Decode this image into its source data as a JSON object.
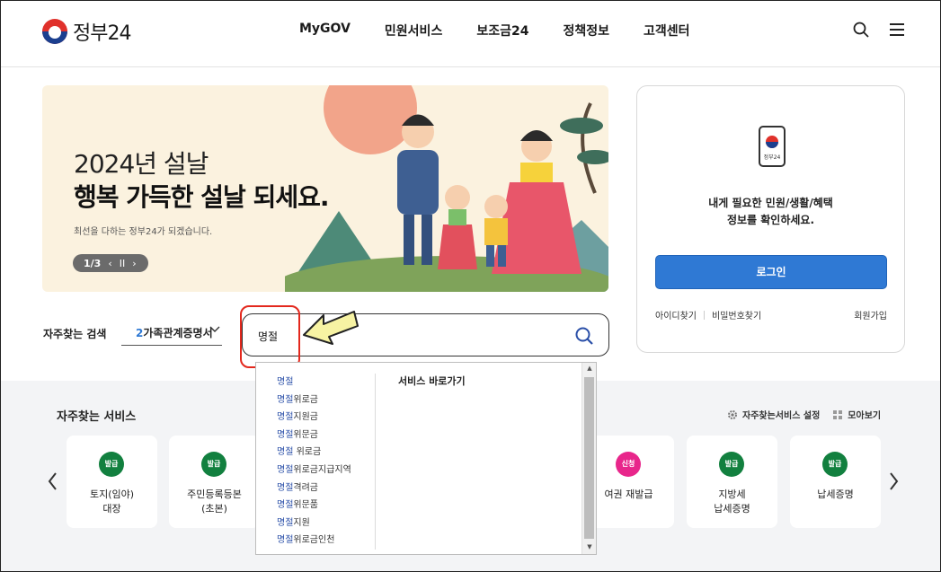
{
  "header": {
    "logo_text": "정부24",
    "nav": [
      "MyGOV",
      "민원서비스",
      "보조금24",
      "정책정보",
      "고객센터"
    ],
    "icons": [
      "search-icon",
      "hamburger-menu-icon"
    ]
  },
  "banner": {
    "line1": "2024년 설날",
    "line2": "행복 가득한 설날 되세요.",
    "desc": "최선을 다하는 정부24가 되겠습니다.",
    "pager": "1/3",
    "prev": "‹",
    "pause": "II",
    "next": "›"
  },
  "login": {
    "app_label": "정부24",
    "message_line1": "내게 필요한 민원/생활/혜택",
    "message_line2": "정보를 확인하세요.",
    "button": "로그인",
    "find_id": "아이디찾기",
    "find_pw": "비밀번호찾기",
    "join": "회원가입"
  },
  "search": {
    "fav_label": "자주찾는 검색",
    "fav_num": "2",
    "fav_value": "가족관계증명서",
    "query": "명절"
  },
  "autocomplete": {
    "items": [
      {
        "hl": "명절",
        "rest": ""
      },
      {
        "hl": "명절",
        "rest": "위로금"
      },
      {
        "hl": "명절",
        "rest": "지원금"
      },
      {
        "hl": "명절",
        "rest": "위문금"
      },
      {
        "hl": "명절",
        "rest": " 위로금"
      },
      {
        "hl": "명절",
        "rest": "위로금지급지역"
      },
      {
        "hl": "명절",
        "rest": "격려금"
      },
      {
        "hl": "명절",
        "rest": "위문품"
      },
      {
        "hl": "명절",
        "rest": "지원"
      },
      {
        "hl": "명절",
        "rest": "위로금인천"
      }
    ],
    "goto_title": "서비스 바로가기"
  },
  "services": {
    "title": "자주찾는 서비스",
    "setting": "자주찾는서비스 설정",
    "view_all": "모아보기",
    "cards": [
      {
        "badge": "발급",
        "color": "green",
        "line1": "토지(임야)",
        "line2": "대장"
      },
      {
        "badge": "발급",
        "color": "green",
        "line1": "주민등록등본",
        "line2": "(초본)"
      },
      {
        "badge": "신청",
        "color": "pink",
        "line1": "여권 재발급",
        "line2": ""
      },
      {
        "badge": "발급",
        "color": "green",
        "line1": "지방세",
        "line2": "납세증명"
      },
      {
        "badge": "발급",
        "color": "green",
        "line1": "납세증명",
        "line2": ""
      }
    ]
  },
  "colors": {
    "accent_blue": "#2f79d4",
    "badge_green": "#12803f",
    "badge_pink": "#e8268b",
    "annotation_red": "#e3281d",
    "annotation_arrow": "#f7f3a3"
  }
}
